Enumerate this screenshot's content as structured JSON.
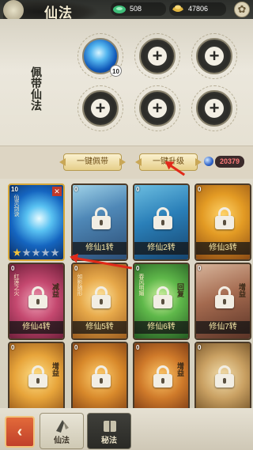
{
  "header": {
    "title": "仙法",
    "resources": [
      {
        "name": "jade",
        "value": "508"
      },
      {
        "name": "gold",
        "value": "47806"
      }
    ]
  },
  "equip": {
    "label": "佩带仙法",
    "slots": [
      {
        "state": "equipped",
        "level": "10"
      },
      {
        "state": "empty"
      },
      {
        "state": "empty"
      },
      {
        "state": "empty"
      },
      {
        "state": "empty"
      },
      {
        "state": "empty"
      }
    ]
  },
  "actions": {
    "equip_all": "一键佩带",
    "upgrade_all": "一键升级",
    "gem_count": "20379"
  },
  "cards": [
    {
      "num": "10",
      "name": "仙灵剑诀",
      "unlocked": true,
      "stars": 1,
      "label": ""
    },
    {
      "num": "0",
      "name": "",
      "unlocked": false,
      "label": "修仙1转"
    },
    {
      "num": "0",
      "name": "",
      "unlocked": false,
      "label": "修仙2转"
    },
    {
      "num": "0",
      "name": "",
      "unlocked": false,
      "label": "修仙3转"
    },
    {
      "num": "0",
      "name": "红莲之火",
      "unlocked": false,
      "label": "修仙4转",
      "stamp": "减益"
    },
    {
      "num": "0",
      "name": "如影随形",
      "unlocked": false,
      "label": "修仙5转"
    },
    {
      "num": "0",
      "name": "春风明媚",
      "unlocked": false,
      "label": "修仙6转",
      "stamp": "回复"
    },
    {
      "num": "0",
      "name": "",
      "unlocked": false,
      "label": "修仙7转",
      "stamp": "增益"
    },
    {
      "num": "0",
      "name": "",
      "unlocked": false,
      "label": "",
      "stamp": "增益"
    },
    {
      "num": "0",
      "name": "",
      "unlocked": false,
      "label": ""
    },
    {
      "num": "0",
      "name": "",
      "unlocked": false,
      "label": "",
      "stamp": "增益"
    },
    {
      "num": "0",
      "name": "",
      "unlocked": false,
      "label": ""
    }
  ],
  "bottom": {
    "back_symbol": "‹",
    "tabs": [
      {
        "label": "仙法",
        "active": true
      },
      {
        "label": "秘法",
        "active": false
      }
    ]
  },
  "colors": {
    "accent_red": "#e12a1a",
    "gold_text": "#f6e7a8",
    "gem_text": "#ff7a7a"
  }
}
